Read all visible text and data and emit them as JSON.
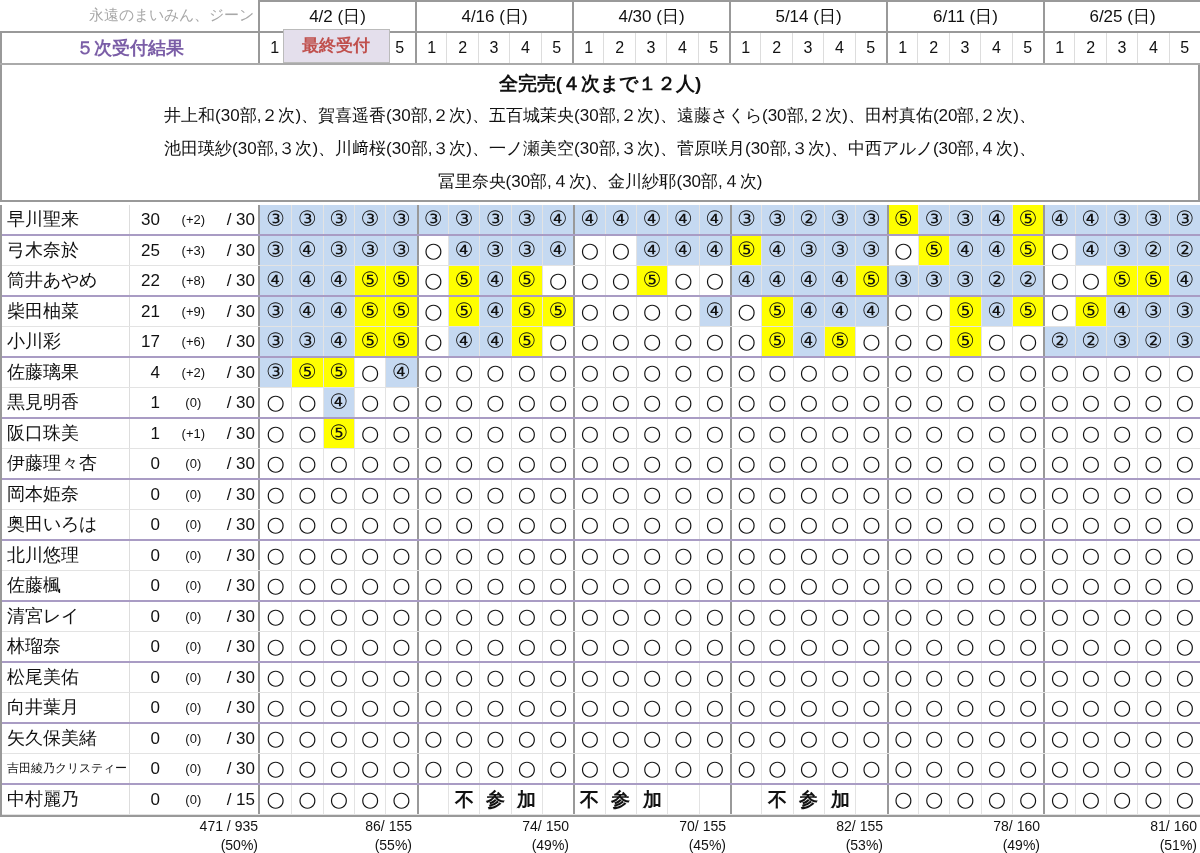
{
  "caption": "永遠のまいみん、ジーン",
  "title": "５次受付結果",
  "dates": [
    {
      "label": "4/2 (日)",
      "slots": [
        "1",
        "5"
      ],
      "overlay": "最終受付",
      "total": "86/ 155",
      "percent": "(55%)"
    },
    {
      "label": "4/16 (日)",
      "slots": [
        "1",
        "2",
        "3",
        "4",
        "5"
      ],
      "total": "74/ 150",
      "percent": "(49%)"
    },
    {
      "label": "4/30 (日)",
      "slots": [
        "1",
        "2",
        "3",
        "4",
        "5"
      ],
      "total": "70/ 155",
      "percent": "(45%)"
    },
    {
      "label": "5/14 (日)",
      "slots": [
        "1",
        "2",
        "3",
        "4",
        "5"
      ],
      "total": "82/ 155",
      "percent": "(53%)"
    },
    {
      "label": "6/11 (日)",
      "slots": [
        "1",
        "2",
        "3",
        "4",
        "5"
      ],
      "total": "78/ 160",
      "percent": "(49%)"
    },
    {
      "label": "6/25 (日)",
      "slots": [
        "1",
        "2",
        "3",
        "4",
        "5"
      ],
      "total": "81/ 160",
      "percent": "(51%)"
    }
  ],
  "notice": {
    "heading": "全完売(４次まで１２人)",
    "lines": [
      "井上和(30部,２次)、賀喜遥香(30部,２次)、五百城茉央(30部,２次)、遠藤さくら(30部,２次)、田村真佑(20部,２次)、",
      "池田瑛紗(30部,３次)、川﨑桜(30部,３次)、一ノ瀬美空(30部,３次)、菅原咲月(30部,３次)、中西アルノ(30部,４次)、",
      "冨里奈央(30部,４次)、金川紗耶(30部,４次)"
    ]
  },
  "rows": [
    {
      "name": "早川聖来",
      "count": "30",
      "delta": "(+2)",
      "quota": "/ 30",
      "cells": [
        {
          "mark": "③",
          "color": "#c5d9f1"
        },
        {
          "mark": "③",
          "color": "#c5d9f1"
        },
        {
          "mark": "③",
          "color": "#c5d9f1"
        },
        {
          "mark": "③",
          "color": "#c5d9f1"
        },
        {
          "mark": "③",
          "color": "#c5d9f1"
        },
        {
          "mark": "③",
          "color": "#c5d9f1"
        },
        {
          "mark": "③",
          "color": "#c5d9f1"
        },
        {
          "mark": "③",
          "color": "#c5d9f1"
        },
        {
          "mark": "③",
          "color": "#c5d9f1"
        },
        {
          "mark": "④",
          "color": "#c5d9f1"
        },
        {
          "mark": "④",
          "color": "#c5d9f1"
        },
        {
          "mark": "④",
          "color": "#c5d9f1"
        },
        {
          "mark": "④",
          "color": "#c5d9f1"
        },
        {
          "mark": "④",
          "color": "#c5d9f1"
        },
        {
          "mark": "④",
          "color": "#c5d9f1"
        },
        {
          "mark": "③",
          "color": "#c5d9f1"
        },
        {
          "mark": "③",
          "color": "#c5d9f1"
        },
        {
          "mark": "②",
          "color": "#c5d9f1"
        },
        {
          "mark": "③",
          "color": "#c5d9f1"
        },
        {
          "mark": "③",
          "color": "#c5d9f1"
        },
        {
          "mark": "⑤",
          "color": "#ffff00"
        },
        {
          "mark": "③",
          "color": "#c5d9f1"
        },
        {
          "mark": "③",
          "color": "#c5d9f1"
        },
        {
          "mark": "④",
          "color": "#c5d9f1"
        },
        {
          "mark": "⑤",
          "color": "#ffff00"
        },
        {
          "mark": "④",
          "color": "#c5d9f1"
        },
        {
          "mark": "④",
          "color": "#c5d9f1"
        },
        {
          "mark": "③",
          "color": "#c5d9f1"
        },
        {
          "mark": "③",
          "color": "#c5d9f1"
        },
        {
          "mark": "③",
          "color": "#c5d9f1"
        }
      ]
    },
    {
      "name": "弓木奈於",
      "count": "25",
      "delta": "(+3)",
      "quota": "/ 30",
      "cells": [
        {
          "mark": "③",
          "color": "#c5d9f1"
        },
        {
          "mark": "④",
          "color": "#c5d9f1"
        },
        {
          "mark": "③",
          "color": "#c5d9f1"
        },
        {
          "mark": "③",
          "color": "#c5d9f1"
        },
        {
          "mark": "③",
          "color": "#c5d9f1"
        },
        "○",
        {
          "mark": "④",
          "color": "#c5d9f1"
        },
        {
          "mark": "③",
          "color": "#c5d9f1"
        },
        {
          "mark": "③",
          "color": "#c5d9f1"
        },
        {
          "mark": "④",
          "color": "#c5d9f1"
        },
        "○",
        "○",
        {
          "mark": "④",
          "color": "#c5d9f1"
        },
        {
          "mark": "④",
          "color": "#c5d9f1"
        },
        {
          "mark": "④",
          "color": "#c5d9f1"
        },
        {
          "mark": "⑤",
          "color": "#ffff00"
        },
        {
          "mark": "④",
          "color": "#c5d9f1"
        },
        {
          "mark": "③",
          "color": "#c5d9f1"
        },
        {
          "mark": "③",
          "color": "#c5d9f1"
        },
        {
          "mark": "③",
          "color": "#c5d9f1"
        },
        "○",
        {
          "mark": "⑤",
          "color": "#ffff00"
        },
        {
          "mark": "④",
          "color": "#c5d9f1"
        },
        {
          "mark": "④",
          "color": "#c5d9f1"
        },
        {
          "mark": "⑤",
          "color": "#ffff00"
        },
        "○",
        {
          "mark": "④",
          "color": "#c5d9f1"
        },
        {
          "mark": "③",
          "color": "#c5d9f1"
        },
        {
          "mark": "②",
          "color": "#c5d9f1"
        },
        {
          "mark": "②",
          "color": "#c5d9f1"
        }
      ]
    },
    {
      "name": "筒井あやめ",
      "count": "22",
      "delta": "(+8)",
      "quota": "/ 30",
      "cells": [
        {
          "mark": "④",
          "color": "#c5d9f1"
        },
        {
          "mark": "④",
          "color": "#c5d9f1"
        },
        {
          "mark": "④",
          "color": "#c5d9f1"
        },
        {
          "mark": "⑤",
          "color": "#ffff00"
        },
        {
          "mark": "⑤",
          "color": "#ffff00"
        },
        "○",
        {
          "mark": "⑤",
          "color": "#ffff00"
        },
        {
          "mark": "④",
          "color": "#c5d9f1"
        },
        {
          "mark": "⑤",
          "color": "#ffff00"
        },
        "○",
        "○",
        "○",
        {
          "mark": "⑤",
          "color": "#ffff00"
        },
        "○",
        "○",
        {
          "mark": "④",
          "color": "#c5d9f1"
        },
        {
          "mark": "④",
          "color": "#c5d9f1"
        },
        {
          "mark": "④",
          "color": "#c5d9f1"
        },
        {
          "mark": "④",
          "color": "#c5d9f1"
        },
        {
          "mark": "⑤",
          "color": "#ffff00"
        },
        {
          "mark": "③",
          "color": "#c5d9f1"
        },
        {
          "mark": "③",
          "color": "#c5d9f1"
        },
        {
          "mark": "③",
          "color": "#c5d9f1"
        },
        {
          "mark": "②",
          "color": "#c5d9f1"
        },
        {
          "mark": "②",
          "color": "#c5d9f1"
        },
        "○",
        "○",
        {
          "mark": "⑤",
          "color": "#ffff00"
        },
        {
          "mark": "⑤",
          "color": "#ffff00"
        },
        {
          "mark": "④",
          "color": "#c5d9f1"
        }
      ]
    },
    {
      "name": "柴田柚菜",
      "count": "21",
      "delta": "(+9)",
      "quota": "/ 30",
      "cells": [
        {
          "mark": "③",
          "color": "#c5d9f1"
        },
        {
          "mark": "④",
          "color": "#c5d9f1"
        },
        {
          "mark": "④",
          "color": "#c5d9f1"
        },
        {
          "mark": "⑤",
          "color": "#ffff00"
        },
        {
          "mark": "⑤",
          "color": "#ffff00"
        },
        "○",
        {
          "mark": "⑤",
          "color": "#ffff00"
        },
        {
          "mark": "④",
          "color": "#c5d9f1"
        },
        {
          "mark": "⑤",
          "color": "#ffff00"
        },
        {
          "mark": "⑤",
          "color": "#ffff00"
        },
        "○",
        "○",
        "○",
        "○",
        {
          "mark": "④",
          "color": "#c5d9f1"
        },
        "○",
        {
          "mark": "⑤",
          "color": "#ffff00"
        },
        {
          "mark": "④",
          "color": "#c5d9f1"
        },
        {
          "mark": "④",
          "color": "#c5d9f1"
        },
        {
          "mark": "④",
          "color": "#c5d9f1"
        },
        "○",
        "○",
        {
          "mark": "⑤",
          "color": "#ffff00"
        },
        {
          "mark": "④",
          "color": "#c5d9f1"
        },
        {
          "mark": "⑤",
          "color": "#ffff00"
        },
        "○",
        {
          "mark": "⑤",
          "color": "#ffff00"
        },
        {
          "mark": "④",
          "color": "#c5d9f1"
        },
        {
          "mark": "③",
          "color": "#c5d9f1"
        },
        {
          "mark": "③",
          "color": "#c5d9f1"
        }
      ]
    },
    {
      "name": "小川彩",
      "count": "17",
      "delta": "(+6)",
      "quota": "/ 30",
      "cells": [
        {
          "mark": "③",
          "color": "#c5d9f1"
        },
        {
          "mark": "③",
          "color": "#c5d9f1"
        },
        {
          "mark": "④",
          "color": "#c5d9f1"
        },
        {
          "mark": "⑤",
          "color": "#ffff00"
        },
        {
          "mark": "⑤",
          "color": "#ffff00"
        },
        "○",
        {
          "mark": "④",
          "color": "#c5d9f1"
        },
        {
          "mark": "④",
          "color": "#c5d9f1"
        },
        {
          "mark": "⑤",
          "color": "#ffff00"
        },
        "○",
        "○",
        "○",
        "○",
        "○",
        "○",
        "○",
        {
          "mark": "⑤",
          "color": "#ffff00"
        },
        {
          "mark": "④",
          "color": "#c5d9f1"
        },
        {
          "mark": "⑤",
          "color": "#ffff00"
        },
        "○",
        "○",
        "○",
        {
          "mark": "⑤",
          "color": "#ffff00"
        },
        "○",
        "○",
        {
          "mark": "②",
          "color": "#c5d9f1"
        },
        {
          "mark": "②",
          "color": "#c5d9f1"
        },
        {
          "mark": "③",
          "color": "#c5d9f1"
        },
        {
          "mark": "②",
          "color": "#c5d9f1"
        },
        {
          "mark": "③",
          "color": "#c5d9f1"
        }
      ]
    },
    {
      "name": "佐藤璃果",
      "count": "4",
      "delta": "(+2)",
      "quota": "/ 30",
      "cells": [
        {
          "mark": "③",
          "color": "#c5d9f1"
        },
        {
          "mark": "⑤",
          "color": "#ffff00"
        },
        {
          "mark": "⑤",
          "color": "#ffff00"
        },
        "○",
        {
          "mark": "④",
          "color": "#c5d9f1"
        },
        "○",
        "○",
        "○",
        "○",
        "○",
        "○",
        "○",
        "○",
        "○",
        "○",
        "○",
        "○",
        "○",
        "○",
        "○",
        "○",
        "○",
        "○",
        "○",
        "○",
        "○",
        "○",
        "○",
        "○",
        "○"
      ]
    },
    {
      "name": "黒見明香",
      "count": "1",
      "delta": "(0)",
      "quota": "/ 30",
      "cells": [
        "○",
        "○",
        {
          "mark": "④",
          "color": "#c5d9f1"
        },
        "○",
        "○",
        "○",
        "○",
        "○",
        "○",
        "○",
        "○",
        "○",
        "○",
        "○",
        "○",
        "○",
        "○",
        "○",
        "○",
        "○",
        "○",
        "○",
        "○",
        "○",
        "○",
        "○",
        "○",
        "○",
        "○",
        "○"
      ]
    },
    {
      "name": "阪口珠美",
      "count": "1",
      "delta": "(+1)",
      "quota": "/ 30",
      "cells": [
        "○",
        "○",
        {
          "mark": "⑤",
          "color": "#ffff00"
        },
        "○",
        "○",
        "○",
        "○",
        "○",
        "○",
        "○",
        "○",
        "○",
        "○",
        "○",
        "○",
        "○",
        "○",
        "○",
        "○",
        "○",
        "○",
        "○",
        "○",
        "○",
        "○",
        "○",
        "○",
        "○",
        "○",
        "○"
      ]
    },
    {
      "name": "伊藤理々杏",
      "count": "0",
      "delta": "(0)",
      "quota": "/ 30",
      "cells": [
        "○",
        "○",
        "○",
        "○",
        "○",
        "○",
        "○",
        "○",
        "○",
        "○",
        "○",
        "○",
        "○",
        "○",
        "○",
        "○",
        "○",
        "○",
        "○",
        "○",
        "○",
        "○",
        "○",
        "○",
        "○",
        "○",
        "○",
        "○",
        "○",
        "○"
      ]
    },
    {
      "name": "岡本姫奈",
      "count": "0",
      "delta": "(0)",
      "quota": "/ 30",
      "cells": [
        "○",
        "○",
        "○",
        "○",
        "○",
        "○",
        "○",
        "○",
        "○",
        "○",
        "○",
        "○",
        "○",
        "○",
        "○",
        "○",
        "○",
        "○",
        "○",
        "○",
        "○",
        "○",
        "○",
        "○",
        "○",
        "○",
        "○",
        "○",
        "○",
        "○"
      ]
    },
    {
      "name": "奥田いろは",
      "count": "0",
      "delta": "(0)",
      "quota": "/ 30",
      "cells": [
        "○",
        "○",
        "○",
        "○",
        "○",
        "○",
        "○",
        "○",
        "○",
        "○",
        "○",
        "○",
        "○",
        "○",
        "○",
        "○",
        "○",
        "○",
        "○",
        "○",
        "○",
        "○",
        "○",
        "○",
        "○",
        "○",
        "○",
        "○",
        "○",
        "○"
      ]
    },
    {
      "name": "北川悠理",
      "count": "0",
      "delta": "(0)",
      "quota": "/ 30",
      "cells": [
        "○",
        "○",
        "○",
        "○",
        "○",
        "○",
        "○",
        "○",
        "○",
        "○",
        "○",
        "○",
        "○",
        "○",
        "○",
        "○",
        "○",
        "○",
        "○",
        "○",
        "○",
        "○",
        "○",
        "○",
        "○",
        "○",
        "○",
        "○",
        "○",
        "○"
      ]
    },
    {
      "name": "佐藤楓",
      "count": "0",
      "delta": "(0)",
      "quota": "/ 30",
      "cells": [
        "○",
        "○",
        "○",
        "○",
        "○",
        "○",
        "○",
        "○",
        "○",
        "○",
        "○",
        "○",
        "○",
        "○",
        "○",
        "○",
        "○",
        "○",
        "○",
        "○",
        "○",
        "○",
        "○",
        "○",
        "○",
        "○",
        "○",
        "○",
        "○",
        "○"
      ]
    },
    {
      "name": "清宮レイ",
      "count": "0",
      "delta": "(0)",
      "quota": "/ 30",
      "cells": [
        "○",
        "○",
        "○",
        "○",
        "○",
        "○",
        "○",
        "○",
        "○",
        "○",
        "○",
        "○",
        "○",
        "○",
        "○",
        "○",
        "○",
        "○",
        "○",
        "○",
        "○",
        "○",
        "○",
        "○",
        "○",
        "○",
        "○",
        "○",
        "○",
        "○"
      ]
    },
    {
      "name": "林瑠奈",
      "count": "0",
      "delta": "(0)",
      "quota": "/ 30",
      "cells": [
        "○",
        "○",
        "○",
        "○",
        "○",
        "○",
        "○",
        "○",
        "○",
        "○",
        "○",
        "○",
        "○",
        "○",
        "○",
        "○",
        "○",
        "○",
        "○",
        "○",
        "○",
        "○",
        "○",
        "○",
        "○",
        "○",
        "○",
        "○",
        "○",
        "○"
      ]
    },
    {
      "name": "松尾美佑",
      "count": "0",
      "delta": "(0)",
      "quota": "/ 30",
      "cells": [
        "○",
        "○",
        "○",
        "○",
        "○",
        "○",
        "○",
        "○",
        "○",
        "○",
        "○",
        "○",
        "○",
        "○",
        "○",
        "○",
        "○",
        "○",
        "○",
        "○",
        "○",
        "○",
        "○",
        "○",
        "○",
        "○",
        "○",
        "○",
        "○",
        "○"
      ]
    },
    {
      "name": "向井葉月",
      "count": "0",
      "delta": "(0)",
      "quota": "/ 30",
      "cells": [
        "○",
        "○",
        "○",
        "○",
        "○",
        "○",
        "○",
        "○",
        "○",
        "○",
        "○",
        "○",
        "○",
        "○",
        "○",
        "○",
        "○",
        "○",
        "○",
        "○",
        "○",
        "○",
        "○",
        "○",
        "○",
        "○",
        "○",
        "○",
        "○",
        "○"
      ]
    },
    {
      "name": "矢久保美緒",
      "count": "0",
      "delta": "(0)",
      "quota": "/ 30",
      "cells": [
        "○",
        "○",
        "○",
        "○",
        "○",
        "○",
        "○",
        "○",
        "○",
        "○",
        "○",
        "○",
        "○",
        "○",
        "○",
        "○",
        "○",
        "○",
        "○",
        "○",
        "○",
        "○",
        "○",
        "○",
        "○",
        "○",
        "○",
        "○",
        "○",
        "○"
      ]
    },
    {
      "name": "吉田綾乃クリスティー",
      "count": "0",
      "delta": "(0)",
      "quota": "/ 30",
      "cells": [
        "○",
        "○",
        "○",
        "○",
        "○",
        "○",
        "○",
        "○",
        "○",
        "○",
        "○",
        "○",
        "○",
        "○",
        "○",
        "○",
        "○",
        "○",
        "○",
        "○",
        "○",
        "○",
        "○",
        "○",
        "○",
        "○",
        "○",
        "○",
        "○",
        "○"
      ]
    },
    {
      "name": "中村麗乃",
      "count": "0",
      "delta": "(0)",
      "quota": "/ 15",
      "cells": [
        "○",
        "○",
        "○",
        "○",
        "○",
        {
          "kind": "blank"
        },
        {
          "mark": "不",
          "kind": "absent"
        },
        {
          "mark": "参",
          "kind": "absent"
        },
        {
          "mark": "加",
          "kind": "absent"
        },
        {
          "kind": "blank"
        },
        {
          "mark": "不",
          "kind": "absent"
        },
        {
          "mark": "参",
          "kind": "absent"
        },
        {
          "mark": "加",
          "kind": "absent"
        },
        {
          "kind": "blank"
        },
        {
          "kind": "blank"
        },
        {
          "kind": "blank"
        },
        {
          "mark": "不",
          "kind": "absent"
        },
        {
          "mark": "参",
          "kind": "absent"
        },
        {
          "mark": "加",
          "kind": "absent"
        },
        {
          "kind": "blank"
        },
        "○",
        "○",
        "○",
        "○",
        "○",
        "○",
        "○",
        "○",
        "○",
        "○"
      ]
    }
  ],
  "grand_total": {
    "total": "471 / 935",
    "percent": "(50%)"
  }
}
